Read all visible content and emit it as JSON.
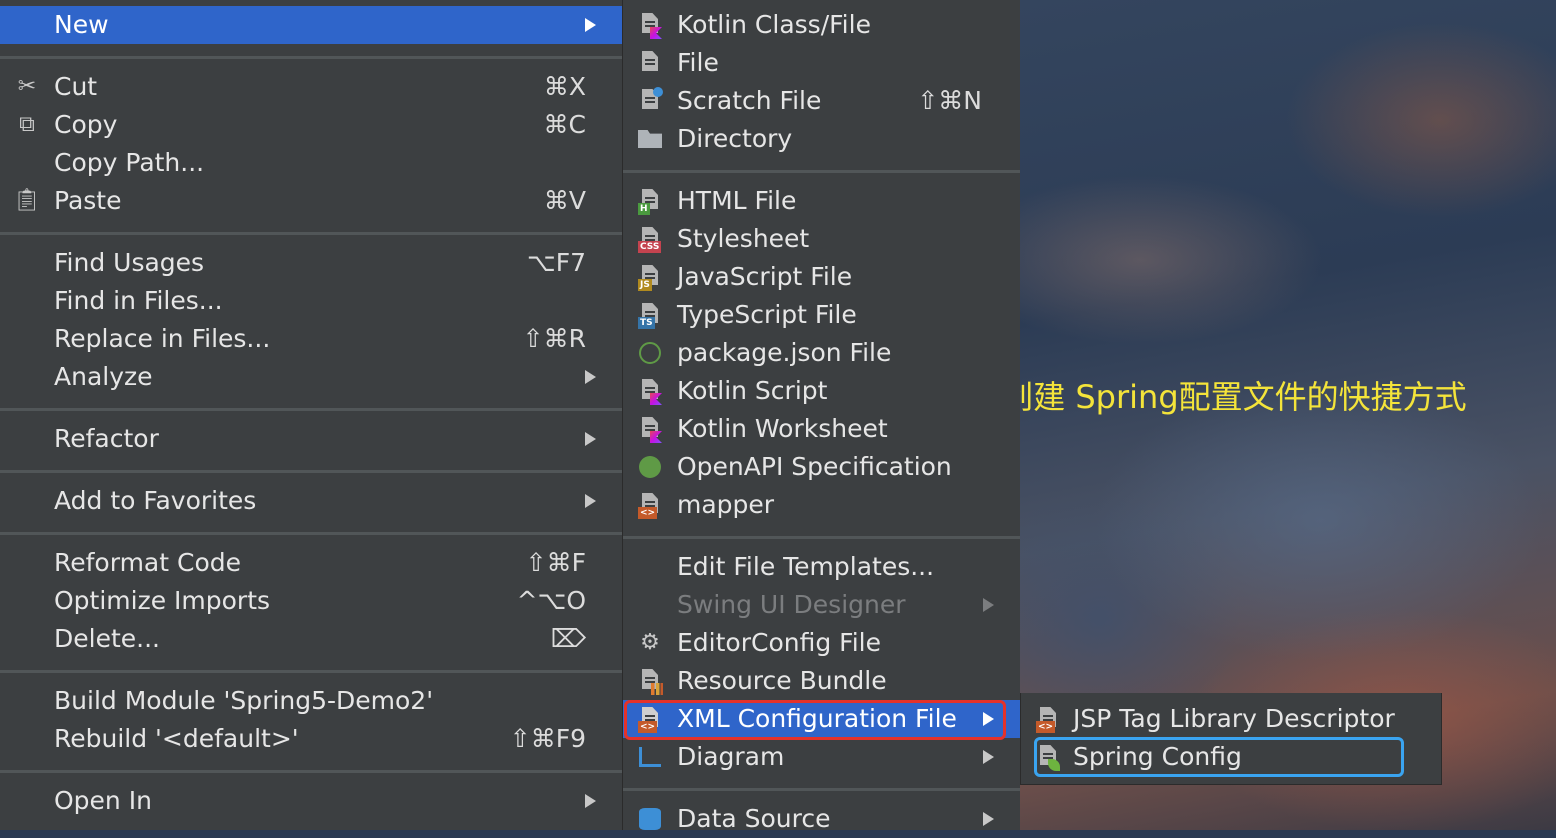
{
  "main_menu": {
    "new": "New",
    "cut": "Cut",
    "cut_sc": "⌘X",
    "copy": "Copy",
    "copy_sc": "⌘C",
    "copy_path": "Copy Path...",
    "paste": "Paste",
    "paste_sc": "⌘V",
    "find_usages": "Find Usages",
    "find_usages_sc": "⌥F7",
    "find_in_files": "Find in Files...",
    "replace_in_files": "Replace in Files...",
    "replace_in_files_sc": "⇧⌘R",
    "analyze": "Analyze",
    "refactor": "Refactor",
    "add_to_favorites": "Add to Favorites",
    "reformat_code": "Reformat Code",
    "reformat_code_sc": "⇧⌘F",
    "optimize_imports": "Optimize Imports",
    "optimize_imports_sc": "^⌥O",
    "delete": "Delete...",
    "delete_sc": "⌦",
    "build_module": "Build Module 'Spring5-Demo2'",
    "rebuild": "Rebuild '<default>'",
    "rebuild_sc": "⇧⌘F9",
    "open_in": "Open In"
  },
  "new_menu": {
    "kotlin_class": "Kotlin Class/File",
    "file": "File",
    "scratch_file": "Scratch File",
    "scratch_file_sc": "⇧⌘N",
    "directory": "Directory",
    "html_file": "HTML File",
    "stylesheet": "Stylesheet",
    "javascript_file": "JavaScript File",
    "typescript_file": "TypeScript File",
    "package_json": "package.json File",
    "kotlin_script": "Kotlin Script",
    "kotlin_worksheet": "Kotlin Worksheet",
    "openapi": "OpenAPI Specification",
    "mapper": "mapper",
    "edit_templates": "Edit File Templates...",
    "swing_ui": "Swing UI Designer",
    "editorconfig": "EditorConfig File",
    "resource_bundle": "Resource Bundle",
    "xml_config": "XML Configuration File",
    "diagram": "Diagram",
    "data_source": "Data Source"
  },
  "xml_menu": {
    "jsp_tag": "JSP Tag Library Descriptor",
    "spring_config": "Spring Config"
  },
  "icon_tags": {
    "html": "H",
    "css": "CSS",
    "js": "JS",
    "ts": "TS"
  },
  "caption": "IDEA创建 Spring配置文件的快捷方式",
  "colors": {
    "selection": "#2f65ca",
    "menu_bg": "#3c3f41",
    "caption": "#f4e43a",
    "highlight_red": "#e4322b",
    "highlight_blue": "#3aa4f0"
  }
}
